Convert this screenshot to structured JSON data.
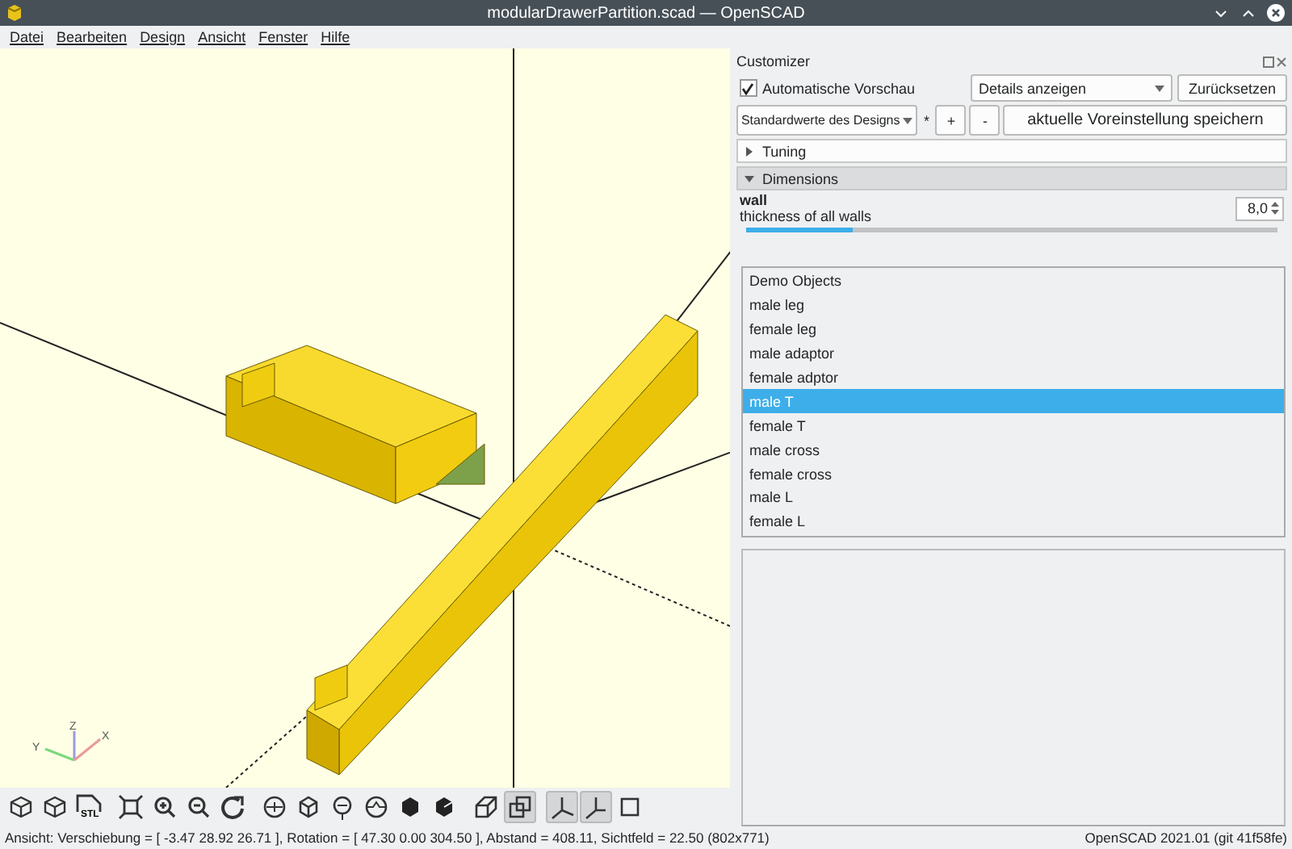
{
  "window": {
    "title": "modularDrawerPartition.scad — OpenSCAD"
  },
  "menu": [
    "Datei",
    "Bearbeiten",
    "Design",
    "Ansicht",
    "Fenster",
    "Hilfe"
  ],
  "viewport": {
    "axes": {
      "x": "X",
      "y": "Y",
      "z": "Z"
    }
  },
  "toolbar": [
    {
      "selected": false
    },
    {
      "selected": false
    },
    {
      "selected": false,
      "label": "STL"
    },
    {
      "selected": false
    },
    {
      "selected": false
    },
    {
      "selected": false
    },
    {
      "selected": false
    },
    {
      "selected": false
    },
    {
      "selected": false
    },
    {
      "selected": false
    },
    {
      "selected": false
    },
    {
      "selected": false
    },
    {
      "selected": false
    },
    {
      "selected": false
    },
    {
      "selected": true
    },
    {
      "selected": true
    },
    {
      "selected": true
    },
    {
      "selected": false
    }
  ],
  "status_bar": {
    "view": "Ansicht: Verschiebung = [ -3.47 28.92 26.71 ], Rotation = [ 47.30 0.00 304.50 ], Abstand = 408.11, Sichtfeld = 22.50 (802x771)",
    "version": "OpenSCAD 2021.01 (git 41f58fe)"
  },
  "customizer": {
    "title": "Customizer",
    "auto_preview": {
      "label": "Automatische Vorschau",
      "checked": true
    },
    "details_combo": "Details anzeigen",
    "reset_button": "Zurücksetzen",
    "preset_combo": "Standardwerte des Designs",
    "modified_mark": "*",
    "add_button": "+",
    "remove_button": "-",
    "save_button": "aktuelle Voreinstellung speichern",
    "sections": [
      {
        "title": "Tuning",
        "expanded": false
      },
      {
        "title": "Dimensions",
        "expanded": true
      }
    ],
    "parameter": {
      "name": "wall",
      "description": "thickness of all walls",
      "value": "8,0",
      "level": 0.2
    },
    "dropdown": [
      {
        "label": "Demo Objects",
        "selected": false
      },
      {
        "label": "male leg",
        "selected": false
      },
      {
        "label": "female leg",
        "selected": false
      },
      {
        "label": "male adaptor",
        "selected": false
      },
      {
        "label": "female adptor",
        "selected": false
      },
      {
        "label": "male T",
        "selected": true
      },
      {
        "label": "female T",
        "selected": false
      },
      {
        "label": "male cross",
        "selected": false
      },
      {
        "label": "female cross",
        "selected": false
      },
      {
        "label": "male L",
        "selected": false
      },
      {
        "label": "female L",
        "selected": false
      }
    ]
  }
}
